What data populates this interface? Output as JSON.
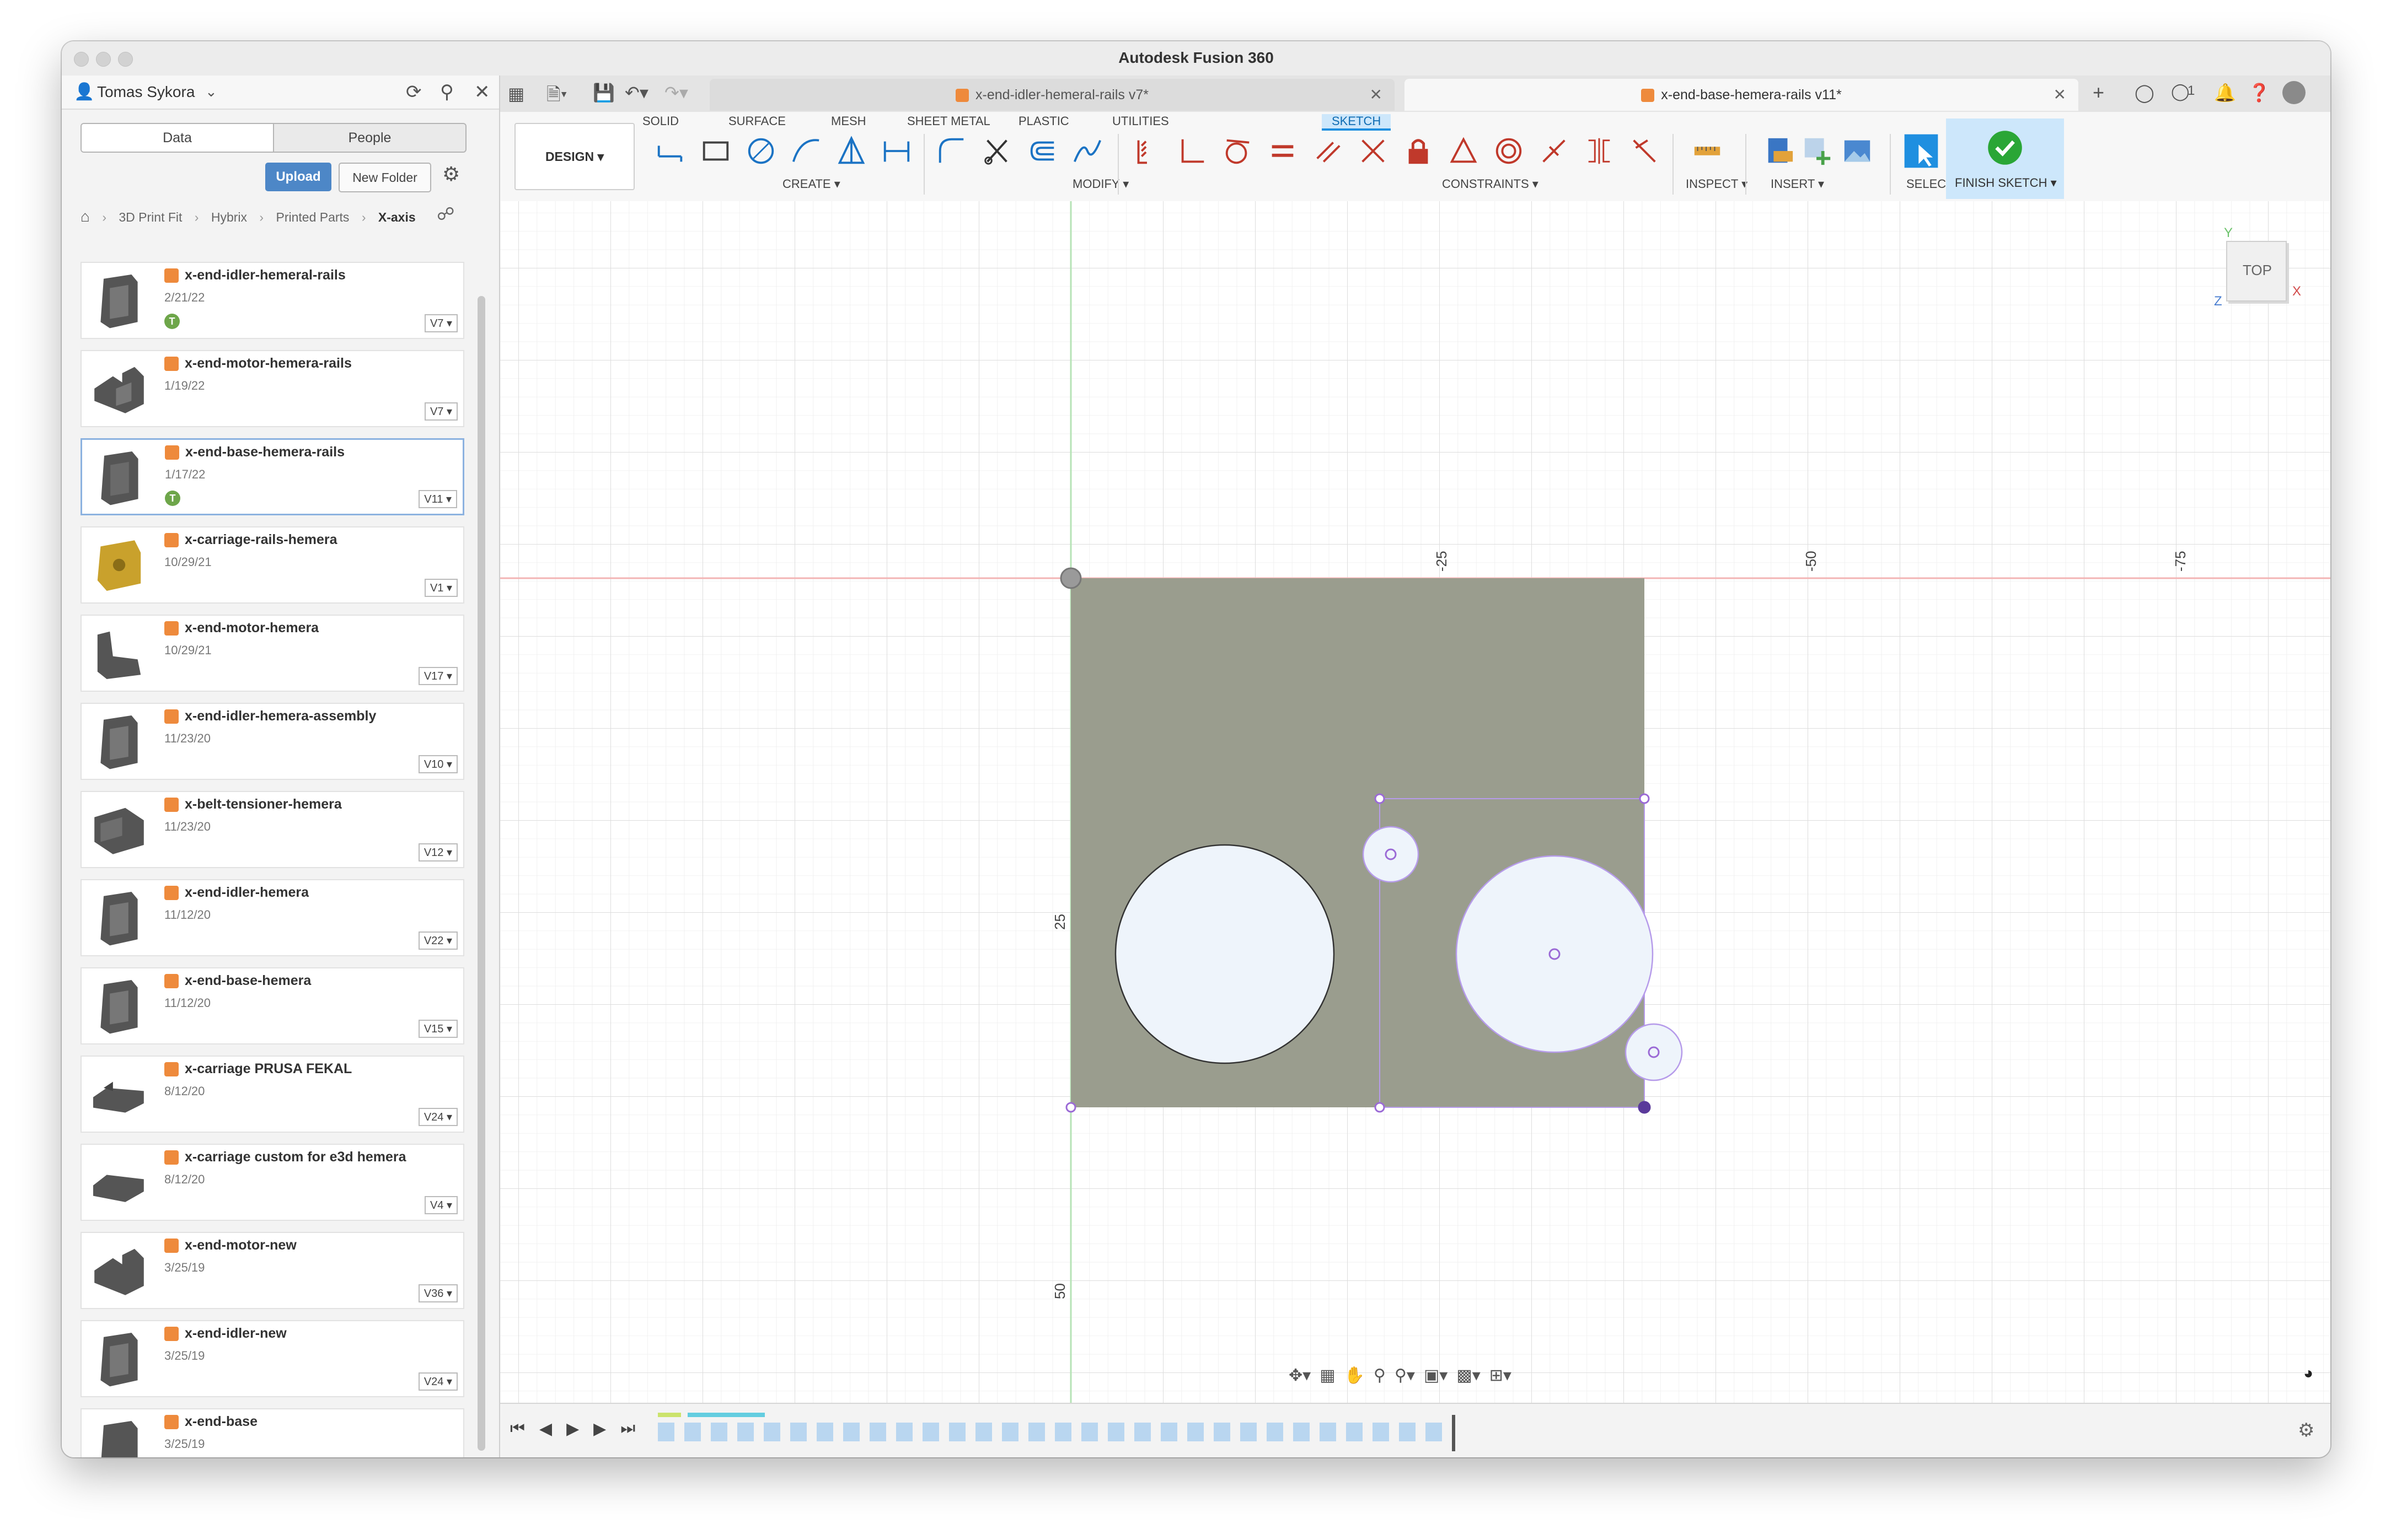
{
  "app": {
    "title": "Autodesk Fusion 360"
  },
  "data_panel": {
    "user": "Tomas Sykora",
    "tabs": {
      "data": "Data",
      "people": "People"
    },
    "upload": "Upload",
    "new_folder": "New Folder",
    "breadcrumb": [
      "3D Print Fit",
      "Hybrix",
      "Printed Parts",
      "X-axis"
    ],
    "files": [
      {
        "name": "x-end-idler-hemeral-rails",
        "date": "2/21/22",
        "version": "V7 ▾"
      },
      {
        "name": "x-end-motor-hemera-rails",
        "date": "1/19/22",
        "version": "V7 ▾"
      },
      {
        "name": "x-end-base-hemera-rails",
        "date": "1/17/22",
        "version": "V11 ▾"
      },
      {
        "name": "x-carriage-rails-hemera",
        "date": "10/29/21",
        "version": "V1 ▾"
      },
      {
        "name": "x-end-motor-hemera",
        "date": "10/29/21",
        "version": "V17 ▾"
      },
      {
        "name": "x-end-idler-hemera-assembly",
        "date": "11/23/20",
        "version": "V10 ▾"
      },
      {
        "name": "x-belt-tensioner-hemera",
        "date": "11/23/20",
        "version": "V12 ▾"
      },
      {
        "name": "x-end-idler-hemera",
        "date": "11/12/20",
        "version": "V22 ▾"
      },
      {
        "name": "x-end-base-hemera",
        "date": "11/12/20",
        "version": "V15 ▾"
      },
      {
        "name": "x-carriage PRUSA FEKAL",
        "date": "8/12/20",
        "version": "V24 ▾"
      },
      {
        "name": "x-carriage custom for e3d hemera",
        "date": "8/12/20",
        "version": "V4 ▾"
      },
      {
        "name": "x-end-motor-new",
        "date": "3/25/19",
        "version": "V36 ▾"
      },
      {
        "name": "x-end-idler-new",
        "date": "3/25/19",
        "version": "V24 ▾"
      },
      {
        "name": "x-end-base",
        "date": "3/25/19",
        "version": ""
      }
    ]
  },
  "tabs": [
    {
      "label": "x-end-idler-hemeral-rails v7*"
    },
    {
      "label": "x-end-base-hemera-rails v11*"
    }
  ],
  "jobs_count": "1",
  "toolbar": {
    "workspace": "DESIGN ▾",
    "tabs": [
      "SOLID",
      "SURFACE",
      "MESH",
      "SHEET METAL",
      "PLASTIC",
      "UTILITIES",
      "SKETCH"
    ],
    "groups": {
      "create": "CREATE ▾",
      "modify": "MODIFY ▾",
      "constraints": "CONSTRAINTS ▾",
      "inspect": "INSPECT ▾",
      "insert": "INSERT ▾",
      "select": "SELECT ▾",
      "finish": "FINISH SKETCH ▾"
    }
  },
  "viewcube": {
    "face": "TOP",
    "x": "X",
    "y": "Y",
    "z": "Z"
  },
  "axis_labels": {
    "top_25": "-25",
    "top_50": "-50",
    "top_75": "-75",
    "left_25": "25",
    "left_50": "50"
  },
  "colors": {
    "sketch_fill": "#9a9d8e",
    "circle_fill": "#eef4fb",
    "constraint_purple": "#9b6ad6",
    "accent": "#1f8fe0",
    "finish_green": "#2aa636"
  }
}
